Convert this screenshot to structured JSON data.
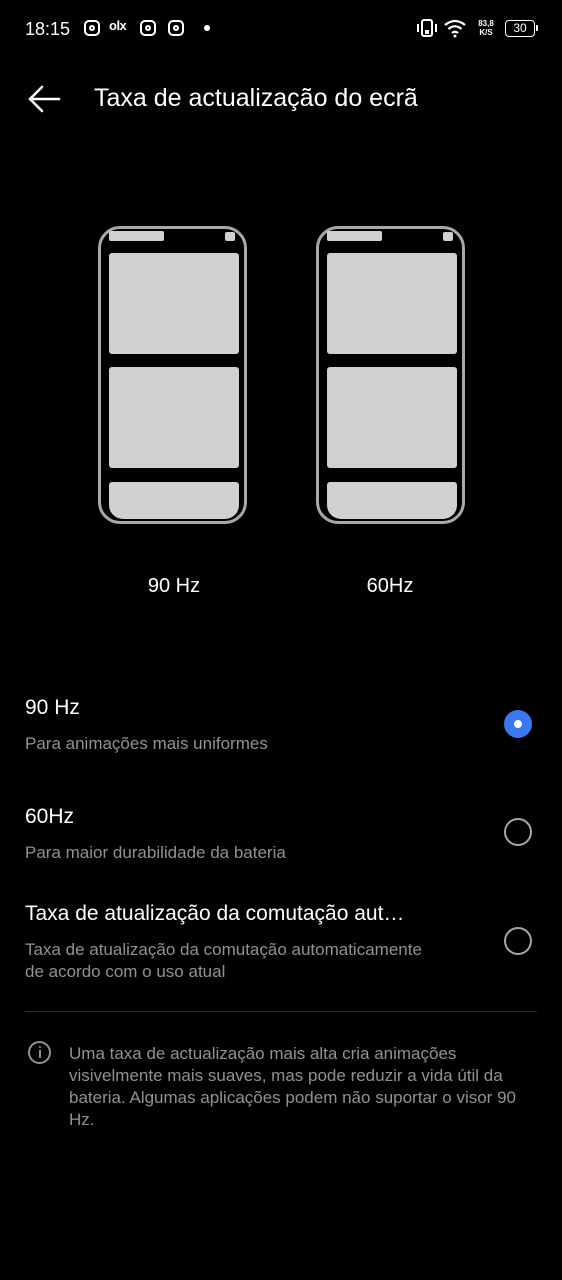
{
  "status_bar": {
    "time": "18:15",
    "notification_icons": [
      "instagram-icon",
      "olx-icon",
      "instagram-icon",
      "instagram-icon",
      "dot-icon"
    ],
    "olx_label": "olx",
    "speed_value": "83,8",
    "speed_unit": "K/S",
    "battery": "30"
  },
  "header": {
    "title": "Taxa de actualização do ecrã",
    "back_icon": "arrow-left-icon"
  },
  "preview": {
    "left_label": "90 Hz",
    "right_label": "60Hz"
  },
  "options": [
    {
      "title": "90 Hz",
      "description": "Para animações mais uniformes",
      "selected": true
    },
    {
      "title": "60Hz",
      "description": "Para maior durabilidade da bateria",
      "selected": false
    },
    {
      "title": "Taxa de atualização da comutação aut…",
      "description": "Taxa de atualização da comutação automaticamente de acordo com o uso atual",
      "selected": false
    }
  ],
  "info": {
    "icon": "info-icon",
    "text": "Uma taxa de actualização mais alta cria animações visivelmente mais suaves, mas pode reduzir a vida útil da bateria. Algumas aplicações podem não suportar o visor 90 Hz."
  },
  "colors": {
    "background": "#000000",
    "accent": "#3a78f2",
    "secondary_text": "#8f9196",
    "phone_frame": "#a6a8ad",
    "phone_block": "#d0d0d0"
  }
}
